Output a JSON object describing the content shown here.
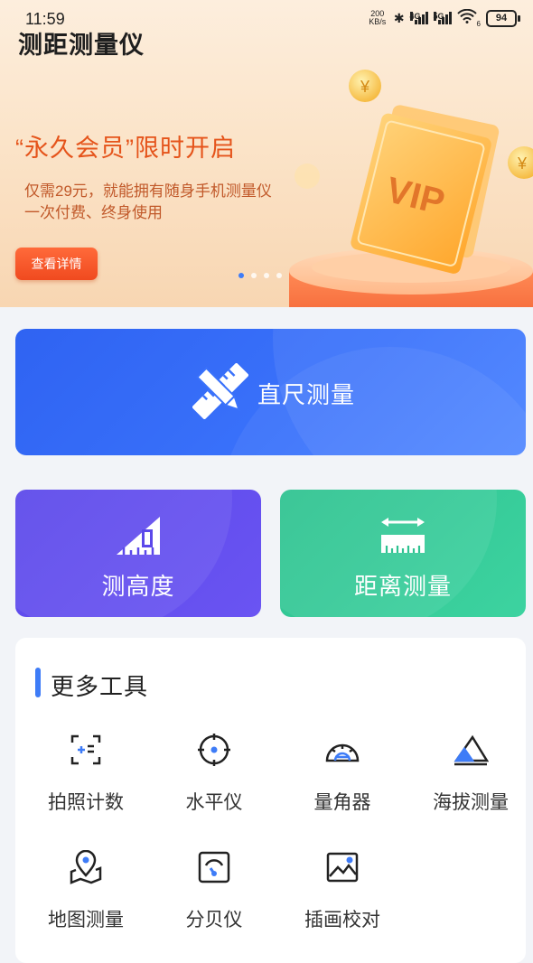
{
  "status_bar": {
    "time": "11:59",
    "net_speed": "200",
    "net_unit": "KB/s",
    "sig1": "4G",
    "sig2": "5G",
    "wifi_sub": "6",
    "battery": "94"
  },
  "app_title": "测距测量仪",
  "banner": {
    "promo_title": "“永久会员”限时开启",
    "promo_line1": "仅需29元，就能拥有随身手机测量仪",
    "promo_line2": "一次付费、终身使用",
    "detail_button": "查看详情",
    "vip_text": "VIP",
    "coin_symbol": "¥",
    "slide_count": 5,
    "active_slide": 1
  },
  "main_cards": {
    "ruler": "直尺测量",
    "height": "测高度",
    "distance": "距离测量"
  },
  "more_tools": {
    "title": "更多工具",
    "items": [
      {
        "label": "拍照计数",
        "icon": "photo-count-icon"
      },
      {
        "label": "水平仪",
        "icon": "level-icon"
      },
      {
        "label": "量角器",
        "icon": "protractor-icon"
      },
      {
        "label": "海拔测量",
        "icon": "altitude-icon"
      },
      {
        "label": "地图测量",
        "icon": "map-measure-icon"
      },
      {
        "label": "分贝仪",
        "icon": "decibel-icon"
      },
      {
        "label": "插画校对",
        "icon": "illustration-check-icon"
      }
    ]
  },
  "colors": {
    "accent_blue": "#3e7cf7",
    "ruler_card": "#3a72fb",
    "height_card": "#5b48ea",
    "distance_card": "#2ec290",
    "promo_orange": "#e5541b"
  }
}
